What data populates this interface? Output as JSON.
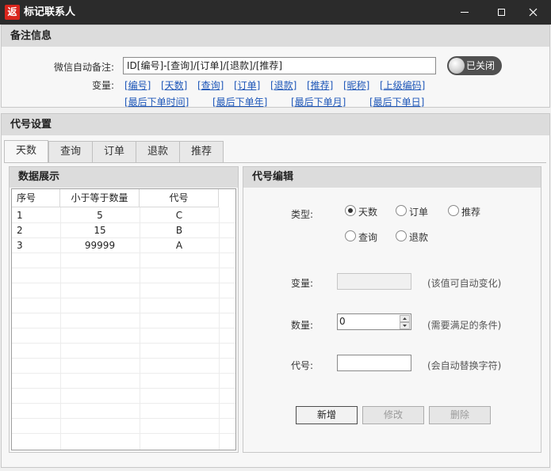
{
  "window": {
    "icon_text": "返",
    "title": "标记联系人"
  },
  "remark_section": {
    "title": "备注信息",
    "auto_remark_label": "微信自动备注:",
    "auto_remark_value": "ID[编号]-[查询]/[订单]/[退款]/[推荐]",
    "toggle_label": "已关闭",
    "variables_label": "变量:",
    "variables_row1": [
      "[编号]",
      "[天数]",
      "[查询]",
      "[订单]",
      "[退款]",
      "[推荐]",
      "[昵称]",
      "[上级编码]"
    ],
    "variables_row2": [
      "[最后下单时间]",
      "[最后下单年]",
      "[最后下单月]",
      "[最后下单日]"
    ]
  },
  "code_section": {
    "title": "代号设置",
    "tabs": [
      "天数",
      "查询",
      "订单",
      "退款",
      "推荐"
    ],
    "active_tab": "天数"
  },
  "data_panel": {
    "title": "数据展示",
    "columns": [
      "序号",
      "小于等于数量",
      "代号"
    ],
    "rows": [
      {
        "index": "1",
        "qty": "5",
        "code": "C"
      },
      {
        "index": "2",
        "qty": "15",
        "code": "B"
      },
      {
        "index": "3",
        "qty": "99999",
        "code": "A"
      }
    ]
  },
  "edit_panel": {
    "title": "代号编辑",
    "type_label": "类型:",
    "type_options": [
      "天数",
      "订单",
      "推荐",
      "查询",
      "退款"
    ],
    "selected_type": "天数",
    "variable_label": "变量:",
    "variable_value": "",
    "variable_hint": "(该值可自动变化)",
    "quantity_label": "数量:",
    "quantity_value": "0",
    "quantity_hint": "(需要满足的条件)",
    "code_label": "代号:",
    "code_value": "",
    "code_hint": "(会自动替换字符)",
    "buttons": {
      "add": "新增",
      "modify": "修改",
      "delete": "删除"
    }
  }
}
